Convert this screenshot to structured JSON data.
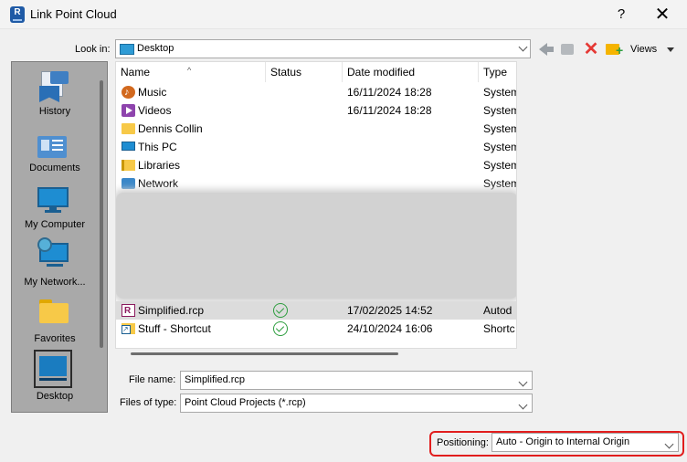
{
  "window": {
    "title": "Link Point Cloud",
    "help_label": "?",
    "close_label": "✕",
    "app_icon_letter": "R"
  },
  "toolbar": {
    "look_in_label": "Look in:",
    "look_in_value": "Desktop",
    "views_label": "Views"
  },
  "places": [
    {
      "label": "History",
      "icon": "history-icon"
    },
    {
      "label": "Documents",
      "icon": "documents-icon"
    },
    {
      "label": "My Computer",
      "icon": "computer-icon"
    },
    {
      "label": "My Network...",
      "icon": "network-icon"
    },
    {
      "label": "Favorites",
      "icon": "favorites-icon"
    },
    {
      "label": "Desktop",
      "icon": "desktop-icon",
      "selected": true
    }
  ],
  "columns": {
    "name": "Name",
    "status": "Status",
    "date": "Date modified",
    "type": "Type"
  },
  "files": [
    {
      "name": "Music",
      "status": "",
      "date": "16/11/2024 18:28",
      "type": "System",
      "icon": "music-icon"
    },
    {
      "name": "Videos",
      "status": "",
      "date": "16/11/2024 18:28",
      "type": "System",
      "icon": "videos-icon"
    },
    {
      "name": "Dennis Collin",
      "status": "",
      "date": "",
      "type": "System",
      "icon": "folder-icon"
    },
    {
      "name": "This PC",
      "status": "",
      "date": "",
      "type": "System",
      "icon": "pc-icon"
    },
    {
      "name": "Libraries",
      "status": "",
      "date": "",
      "type": "System",
      "icon": "libraries-icon"
    },
    {
      "name": "Network",
      "status": "",
      "date": "",
      "type": "System",
      "icon": "network-icon"
    },
    {
      "name": "Simplified.rcp",
      "status": "synced",
      "date": "17/02/2025 14:52",
      "type": "Autod",
      "icon": "rcp-icon",
      "selected": true
    },
    {
      "name": "Stuff - Shortcut",
      "status": "synced",
      "date": "24/10/2024 16:06",
      "type": "Shortc",
      "icon": "shortcut-icon"
    }
  ],
  "form": {
    "file_name_label": "File name:",
    "file_name_value": "Simplified.rcp",
    "file_type_label": "Files of type:",
    "file_type_value": "Point Cloud Projects (*.rcp)",
    "positioning_label": "Positioning:",
    "positioning_value": "Auto - Origin to Internal Origin"
  },
  "colors": {
    "highlight_border": "#e11d1d",
    "status_ok": "#2e9e3f"
  }
}
